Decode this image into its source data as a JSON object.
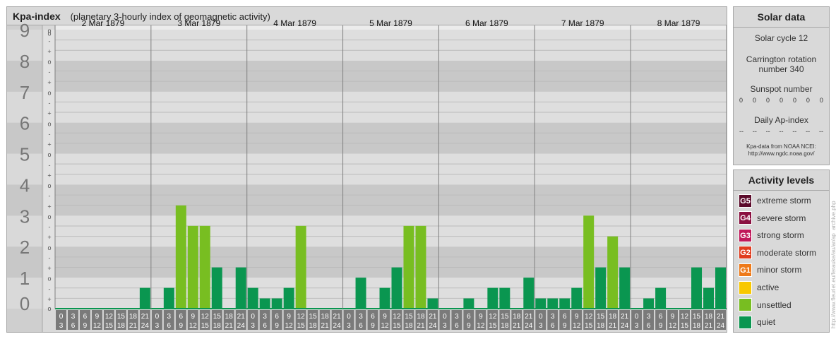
{
  "header": {
    "title": "Kpa-index",
    "subtitle": "(planetary 3-hourly index of geomagnetic activity)"
  },
  "chart_data": {
    "type": "bar",
    "title": "Kpa-index",
    "subtitle": "(planetary 3-hourly index of geomagnetic activity)",
    "ylim": [
      0,
      9
    ],
    "y_ticks": [
      "0",
      "1",
      "2",
      "3",
      "4",
      "5",
      "6",
      "7",
      "8",
      "9"
    ],
    "sub_ticks": [
      "-",
      "o",
      "+"
    ],
    "days": [
      "2 Mar 1879",
      "3 Mar 1879",
      "4 Mar 1879",
      "5 Mar 1879",
      "6 Mar 1879",
      "7 Mar 1879",
      "8 Mar 1879"
    ],
    "hour_labels_top": [
      "0",
      "3",
      "6",
      "9",
      "12",
      "15",
      "18",
      "21"
    ],
    "hour_labels_bottom": [
      "3",
      "6",
      "9",
      "12",
      "15",
      "18",
      "21",
      "24"
    ],
    "values": [
      [
        0,
        0,
        0,
        0,
        0,
        0,
        0,
        0.67
      ],
      [
        0,
        0.67,
        3.33,
        2.67,
        2.67,
        1.33,
        0,
        1.33
      ],
      [
        0.67,
        0.33,
        0.33,
        0.67,
        2.67,
        0,
        0,
        0
      ],
      [
        0,
        1,
        0,
        0.67,
        1.33,
        2.67,
        2.67,
        0.33
      ],
      [
        0,
        0,
        0.33,
        0,
        0.67,
        0.67,
        0,
        1
      ],
      [
        0.33,
        0.33,
        0.33,
        0.67,
        3,
        1.33,
        2.33,
        1.33
      ],
      [
        0,
        0.33,
        0.67,
        0,
        0,
        1.33,
        0.67,
        1.33
      ]
    ],
    "level_colors": {
      "quiet": "#0a9650",
      "unsettled": "#78be21"
    }
  },
  "solar": {
    "title": "Solar data",
    "cycle": "Solar cycle 12",
    "carrington_line1": "Carrington rotation",
    "carrington_line2": "number 340",
    "sunspot_label": "Sunspot number",
    "sunspot_values": [
      "0",
      "0",
      "0",
      "0",
      "0",
      "0",
      "0"
    ],
    "ap_label": "Daily Ap-index",
    "ap_values": [
      "--",
      "--",
      "--",
      "--",
      "--",
      "--",
      "--"
    ],
    "source_line1": "Kpa-data from NOAA NCEI:",
    "source_line2": "http://www.ngdc.noaa.gov/"
  },
  "levels": {
    "title": "Activity levels",
    "items": [
      {
        "code": "G5",
        "label": "extreme storm",
        "color": "#5b0a2a"
      },
      {
        "code": "G4",
        "label": "severe storm",
        "color": "#8a1040"
      },
      {
        "code": "G3",
        "label": "strong storm",
        "color": "#c0185a"
      },
      {
        "code": "G2",
        "label": "moderate storm",
        "color": "#e03c1e"
      },
      {
        "code": "G1",
        "label": "minor storm",
        "color": "#ee7a1a"
      },
      {
        "code": "",
        "label": "active",
        "color": "#f8c800"
      },
      {
        "code": "",
        "label": "unsettled",
        "color": "#78be21"
      },
      {
        "code": "",
        "label": "quiet",
        "color": "#0a9650"
      }
    ]
  },
  "credit": "http://www.fleuriet.eu/ferauke/au/ar/ap_archive.php"
}
